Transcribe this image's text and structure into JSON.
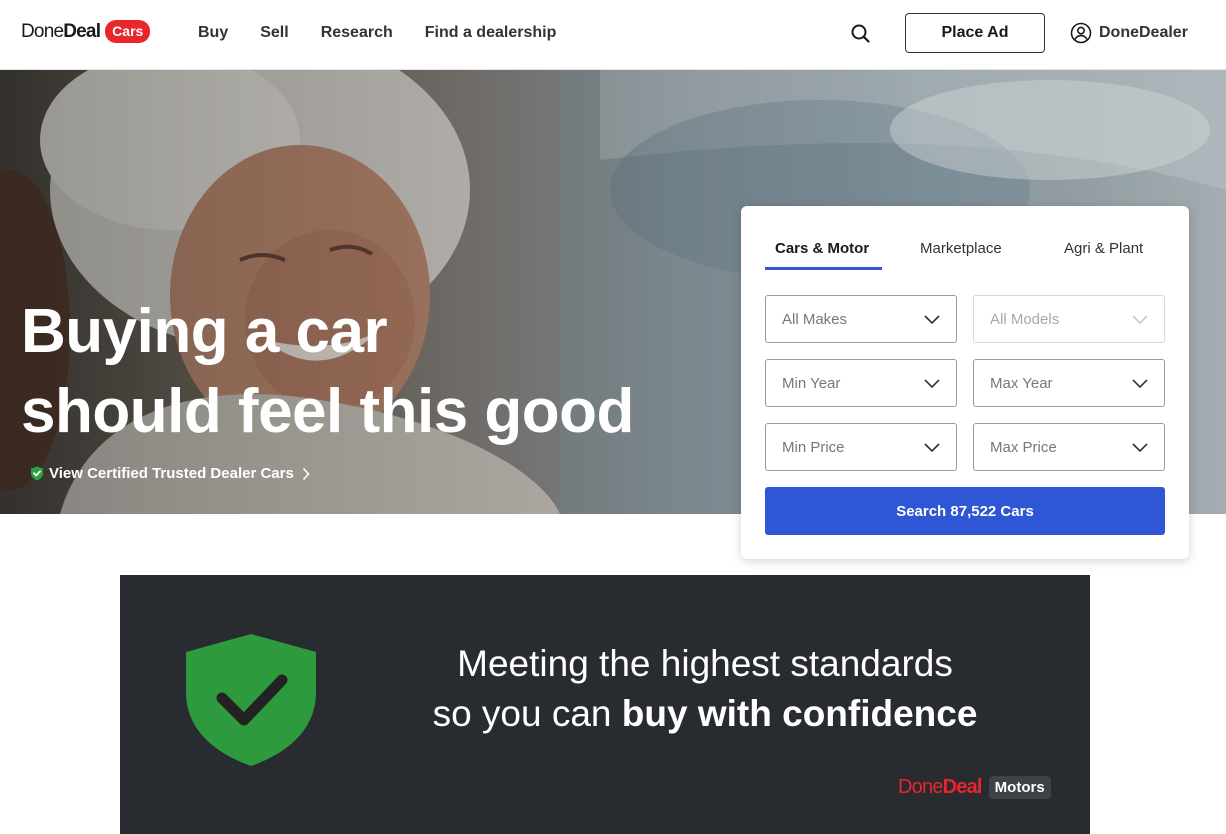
{
  "brand": {
    "logo_done": "Done",
    "logo_deal": "Deal",
    "logo_badge": "Cars",
    "accent_red": "#e8262c",
    "primary_blue": "#2f56d5"
  },
  "header": {
    "nav": [
      {
        "label": "Buy"
      },
      {
        "label": "Sell"
      },
      {
        "label": "Research"
      },
      {
        "label": "Find a dealership"
      }
    ],
    "search_icon": "search-icon",
    "place_ad_label": "Place Ad",
    "account_icon": "user-circle-icon",
    "account_label": "DoneDealer"
  },
  "hero": {
    "title_line_1": "Buying a car",
    "title_line_2": "should feel this good",
    "certified_link_label": "View Certified Trusted Dealer Cars",
    "certified_icon": "shield-check-icon",
    "certified_icon_color": "#2ea043"
  },
  "search_panel": {
    "tabs": [
      {
        "label": "Cars & Motor",
        "active": true
      },
      {
        "label": "Marketplace",
        "active": false
      },
      {
        "label": "Agri & Plant",
        "active": false
      }
    ],
    "filters": {
      "makes": "All Makes",
      "models": "All Models",
      "min_year": "Min Year",
      "max_year": "Max Year",
      "min_price": "Min Price",
      "max_price": "Max Price"
    },
    "search_button_label": "Search 87,522 Cars"
  },
  "promo_banner": {
    "line_1": "Meeting the highest standards",
    "line_2_regular": "so you can ",
    "line_2_bold": "buy with confidence",
    "shield_color": "#2e9a3e",
    "logo_done": "Done",
    "logo_deal": "Deal",
    "logo_badge": "Motors"
  }
}
